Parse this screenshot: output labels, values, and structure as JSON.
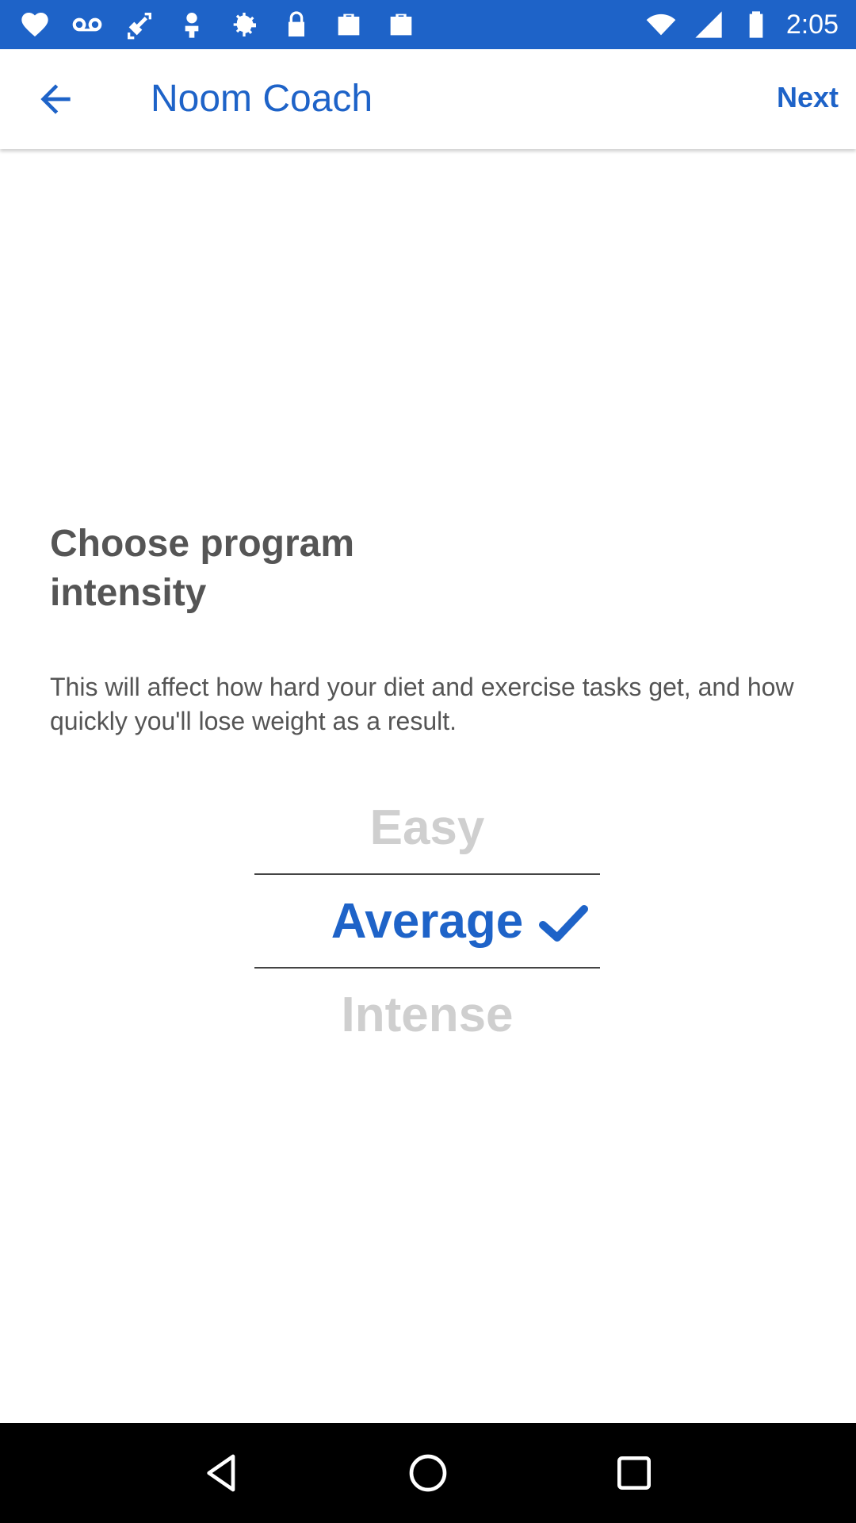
{
  "status_bar": {
    "time": "2:05",
    "left_icons": [
      "heart-icon",
      "voicemail-icon",
      "fake-gps-icon",
      "person-pin-icon",
      "settings-icon",
      "lock-icon",
      "bag-icon",
      "bag-icon"
    ],
    "right_icons": [
      "wifi-icon",
      "signal-icon",
      "battery-icon"
    ],
    "background_color": "#1e63c8"
  },
  "app_bar": {
    "back_icon": "arrow-left-icon",
    "title": "Noom Coach",
    "next_label": "Next",
    "accent_color": "#1e63c8"
  },
  "content": {
    "heading": "Choose program intensity",
    "description": "This will affect how hard your diet and exercise tasks get, and how quickly you'll lose weight as a result.",
    "options": [
      {
        "label": "Easy",
        "selected": false
      },
      {
        "label": "Average",
        "selected": true
      },
      {
        "label": "Intense",
        "selected": false
      }
    ]
  },
  "nav_bar": {
    "buttons": [
      "back-triangle-icon",
      "home-circle-icon",
      "recents-square-icon"
    ]
  }
}
